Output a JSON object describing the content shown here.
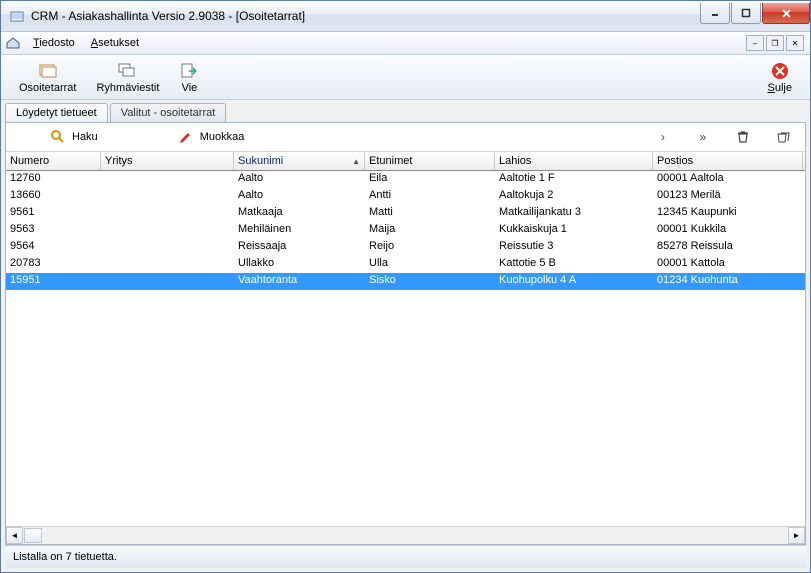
{
  "window": {
    "title": "CRM - Asiakashallinta Versio 2.9038 - [Osoitetarrat]"
  },
  "menu": {
    "file": "Tiedosto",
    "file_u": "T",
    "settings": "Asetukset",
    "settings_u": "A"
  },
  "toolbar": {
    "labels": {
      "label": "Osoitetarrat"
    },
    "group": {
      "label": "Ryhmäviestit"
    },
    "export": {
      "label": "Vie"
    },
    "close": {
      "label": "Sulje",
      "u": "S"
    }
  },
  "tabs": {
    "found": "Löydetyt tietueet",
    "selected": "Valitut - osoitetarrat"
  },
  "toolbar2": {
    "search": "Haku",
    "edit": "Muokkaa"
  },
  "columns": [
    "Numero",
    "Yritys",
    "Sukunimi",
    "Etunimet",
    "Lahios",
    "Postios"
  ],
  "sort_col": 2,
  "rows": [
    {
      "sel": false,
      "cells": [
        "12760",
        "",
        "Aalto",
        "Eila",
        "Aaltotie 1 F",
        "00001 Aaltola"
      ]
    },
    {
      "sel": false,
      "cells": [
        "13660",
        "",
        "Aalto",
        "Antti",
        "Aaltokuja 2",
        "00123 Merilä"
      ]
    },
    {
      "sel": false,
      "cells": [
        "9561",
        "",
        "Matkaaja",
        "Matti",
        "Matkailijankatu 3",
        "12345 Kaupunki"
      ]
    },
    {
      "sel": false,
      "cells": [
        "9563",
        "",
        "Mehiläinen",
        "Maija",
        "Kukkaiskuja 1",
        "00001 Kukkila"
      ]
    },
    {
      "sel": false,
      "cells": [
        "9564",
        "",
        "Reissaaja",
        "Reijo",
        "Reissutie 3",
        "85278 Reissula"
      ]
    },
    {
      "sel": false,
      "cells": [
        "20783",
        "",
        "Ullakko",
        "Ulla",
        "Kattotie 5 B",
        "00001 Kattola"
      ]
    },
    {
      "sel": true,
      "cells": [
        "15951",
        "",
        "Vaahtoranta",
        "Sisko",
        "Kuohupolku 4 A",
        "01234 Kuohunta"
      ]
    }
  ],
  "status": "Listalla on 7 tietuetta."
}
